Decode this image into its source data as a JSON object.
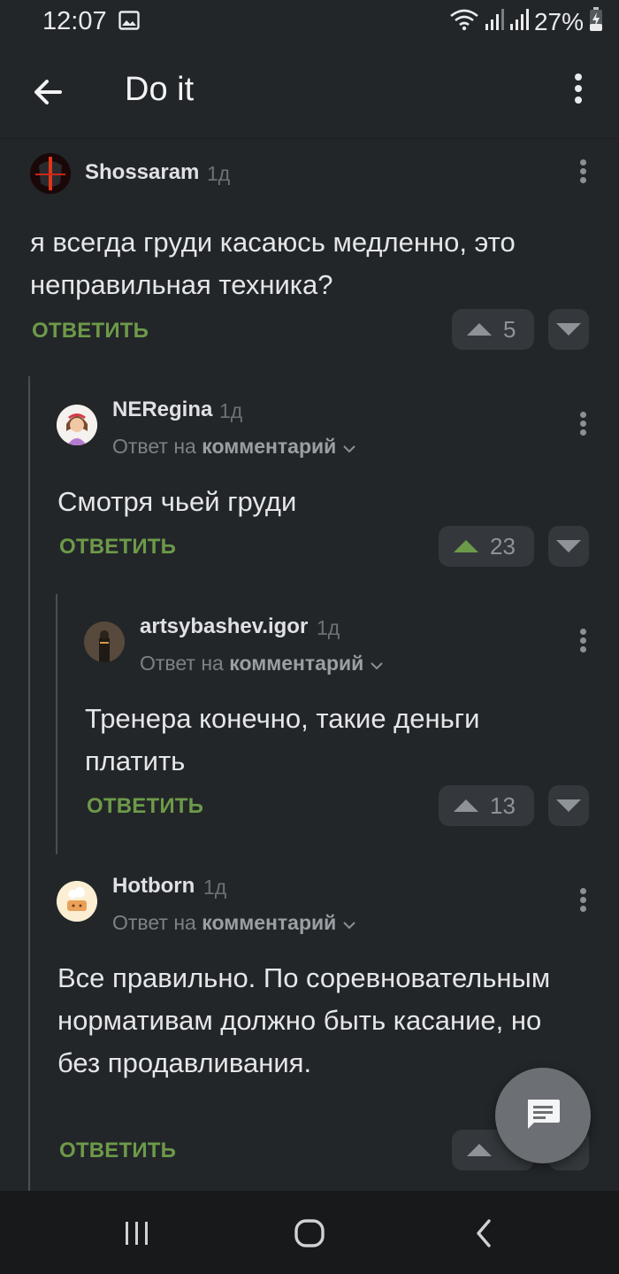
{
  "status_bar": {
    "time": "12:07",
    "battery": "27%",
    "icons": [
      "image-icon",
      "wifi-icon",
      "signal-icon",
      "signal-icon",
      "battery-charging-icon"
    ]
  },
  "app_bar": {
    "title": "Do it"
  },
  "labels": {
    "reply": "ОТВЕТИТЬ",
    "reply_to_prefix": "Ответ на",
    "reply_to_target": "комментарий"
  },
  "comments": [
    {
      "author": "Shossaram",
      "time": "1д",
      "text": "я всегда груди касаюсь медленно, это неправильная техника?",
      "rating": "5",
      "is_reply": false
    },
    {
      "author": "NERegina",
      "time": "1д",
      "text": "Смотря чьей груди",
      "rating": "23",
      "is_reply": true,
      "upvoted": true
    },
    {
      "author": "artsybashev.igor",
      "time": "1д",
      "text": "Тренера конечно, такие деньги платить",
      "rating": "13",
      "is_reply": true
    },
    {
      "author": "Hotborn",
      "time": "1д",
      "text": "Все правильно. По соревновательным нормативам должно быть касание, но без продавливания.",
      "rating": "",
      "is_reply": true
    }
  ],
  "colors": {
    "background": "#232629",
    "reply_accent": "#6d9a49",
    "upvote_active": "#6d9a49",
    "fab": "#6c7074"
  }
}
